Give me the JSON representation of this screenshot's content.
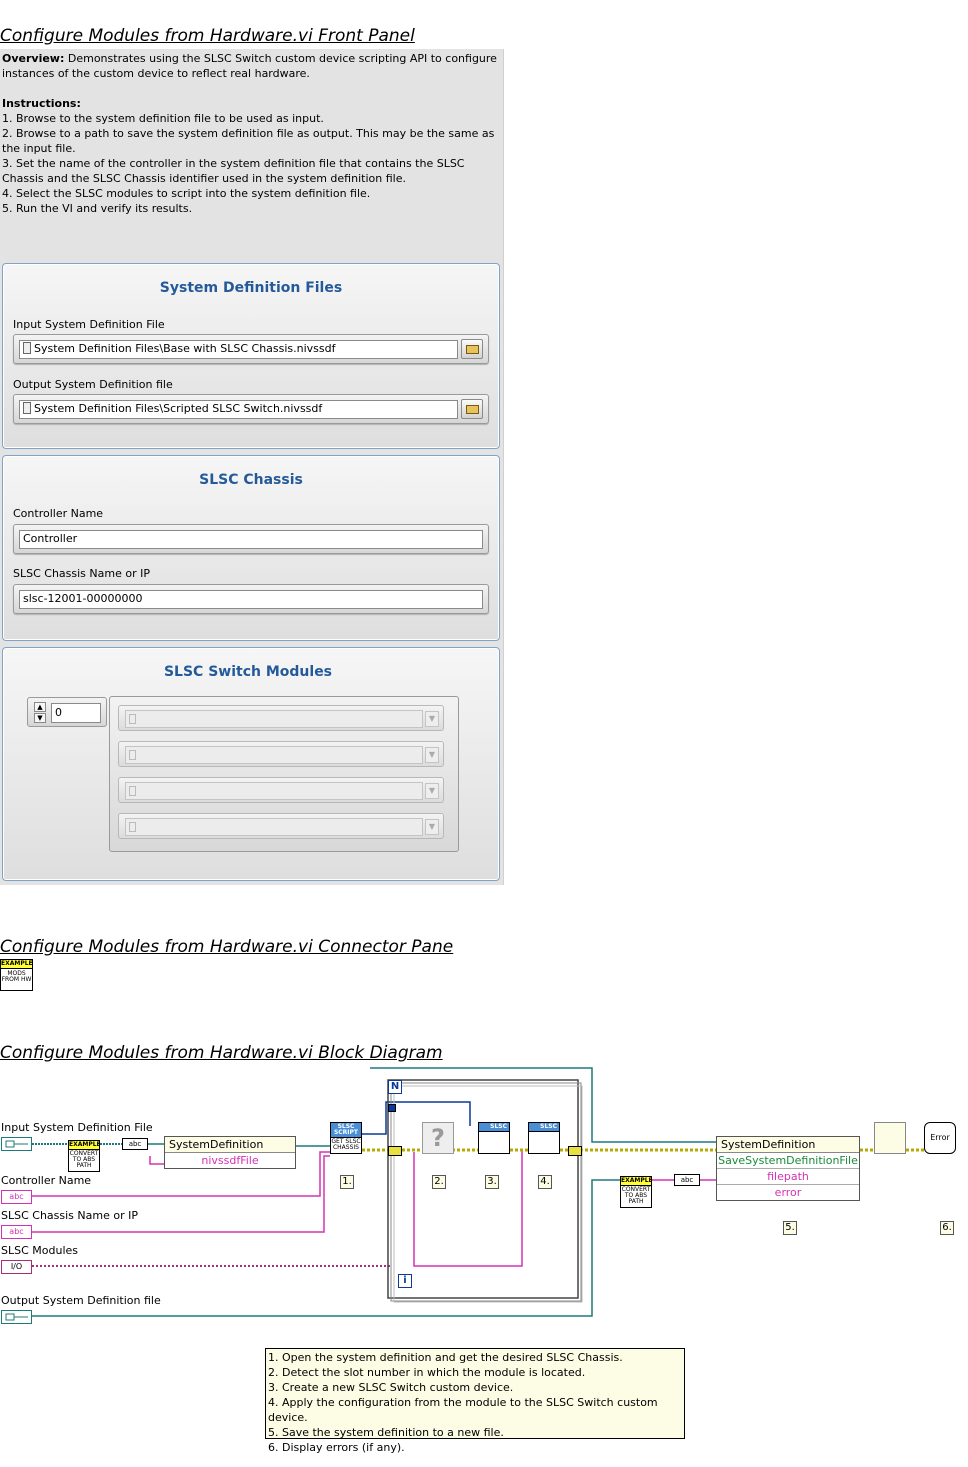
{
  "headings": {
    "front_panel": "Configure Modules from Hardware.vi Front Panel",
    "connector_pane": "Configure Modules from Hardware.vi Connector Pane",
    "block_diagram": "Configure Modules from Hardware.vi Block Diagram"
  },
  "overview": {
    "label": "Overview:",
    "text": " Demonstrates using the SLSC Switch custom device scripting API to configure instances of the custom device to reflect real hardware.",
    "instructions_label": "Instructions:",
    "steps": [
      "1. Browse to the system definition file to be used as input.",
      "2. Browse to a path to save the system definition file as output. This may be the same as the input file.",
      "3. Set the name of the controller in the system definition file that contains the SLSC Chassis and the SLSC Chassis identifier used in the system definition file.",
      "4. Select the SLSC modules to script into the system definition file.",
      "5. Run the VI and verify its results."
    ]
  },
  "system_definition_files": {
    "title": "System Definition Files",
    "input_label": "Input System Definition File",
    "input_value": "System Definition Files\\Base with SLSC Chassis.nivssdf",
    "output_label": "Output System Definition file",
    "output_value": "System Definition Files\\Scripted SLSC Switch.nivssdf"
  },
  "slsc_chassis": {
    "title": "SLSC Chassis",
    "controller_label": "Controller Name",
    "controller_value": "Controller",
    "chassis_label": "SLSC Chassis Name or IP",
    "chassis_value": "slsc-12001-00000000"
  },
  "slsc_switch_modules": {
    "title": "SLSC Switch Modules",
    "index_value": "0"
  },
  "connector_pane": {
    "icon_banner": "EXAMPLE",
    "icon_text": "MODS FROM HW"
  },
  "block_diagram": {
    "labels": {
      "input_file": "Input System Definition File",
      "controller_name": "Controller Name",
      "chassis_name": "SLSC Chassis Name or IP",
      "modules": "SLSC Modules",
      "output_file": "Output System Definition file"
    },
    "terminals": {
      "abc": "abc",
      "io": "I/O"
    },
    "nodes": {
      "example_banner": "EXAMPLE",
      "convert_text": "CONVERT TO ABS PATH",
      "get_chassis": "GET SLSC CHASSIS",
      "slsc_script": "SLSC SCRIPT",
      "slsc": "SLSC",
      "loop_n": "N",
      "loop_i": "i",
      "error": "Error"
    },
    "property_node_1": {
      "header": "SystemDefinition",
      "row": "nivssdfFile"
    },
    "property_node_2": {
      "header": "SystemDefinition",
      "method": "SaveSystemDefinitionFile",
      "filepath": "filepath",
      "error": "error"
    },
    "step_numbers": [
      "1.",
      "2.",
      "3.",
      "4.",
      "5.",
      "6."
    ],
    "notes": [
      "1. Open the system definition and get the desired SLSC Chassis.",
      "2. Detect the slot number in which the module is located.",
      "3. Create a new SLSC Switch custom device.",
      "4. Apply the configuration from the module to the SLSC Switch custom device.",
      "5. Save the system definition to a new file.",
      "6. Display errors (if any)."
    ]
  }
}
